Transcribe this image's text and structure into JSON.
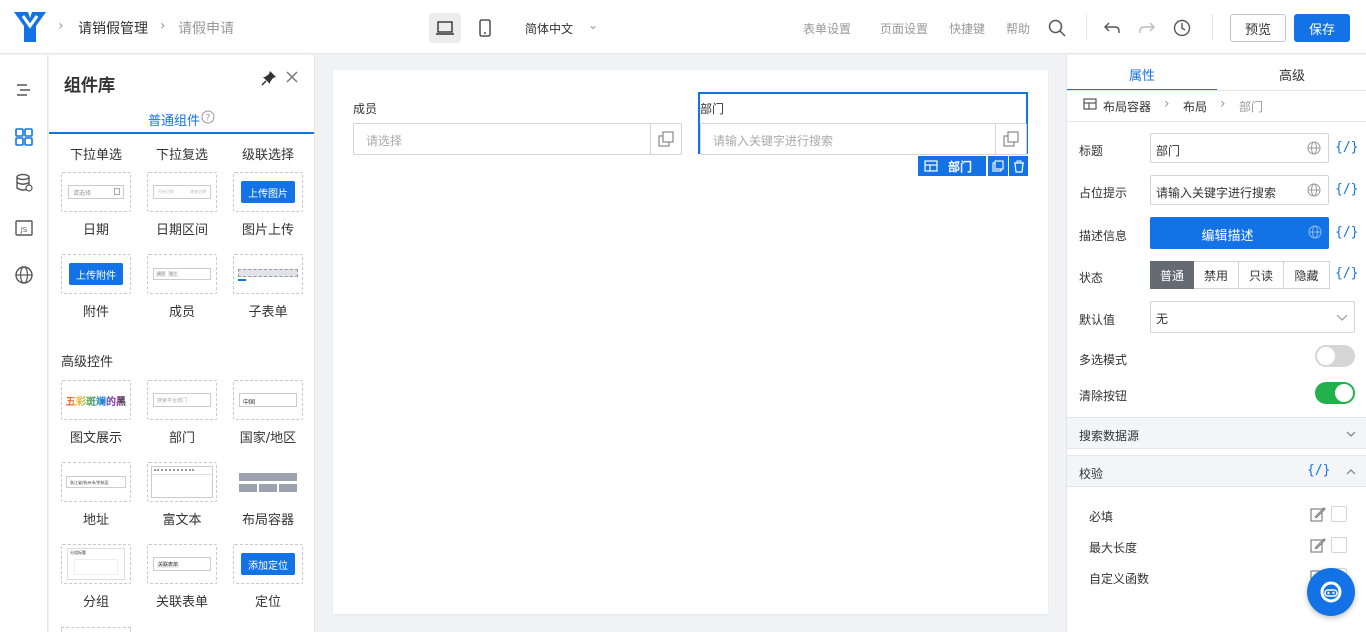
{
  "header": {
    "app_name": "请销假管理",
    "page_name": "请假申请",
    "language": "简体中文",
    "links": [
      "表单设置",
      "页面设置",
      "快捷键",
      "帮助"
    ],
    "preview_label": "预览",
    "save_label": "保存",
    "brand_color": "#1373e6"
  },
  "library": {
    "title": "组件库",
    "tab_label": "普通组件",
    "row0": [
      "下拉单选",
      "下拉复选",
      "级联选择"
    ],
    "row1": [
      "日期",
      "日期区间",
      "图片上传"
    ],
    "row2": [
      "附件",
      "成员",
      "子表单"
    ],
    "advanced_title": "高级控件",
    "row3": [
      "图文展示",
      "部门",
      "国家/地区"
    ],
    "row4": [
      "地址",
      "富文本",
      "布局容器"
    ],
    "row5": [
      "分组",
      "关联表单",
      "定位"
    ],
    "thumbs": {
      "date_ph": "请选择",
      "daterange_start": "开始日期",
      "daterange_end": "结束日期",
      "upload_image": "上传图片",
      "upload_file": "上传附件",
      "member_tag1": "成员",
      "member_tag2": "张三",
      "rich_text": "五彩斑斓的黑",
      "dept_ph": "搜索平台部门",
      "country": "中国",
      "address": "浙江省/杭州市/余杭区",
      "assoc_tag": "关联表单",
      "group_title": "分组标题",
      "locate": "添加定位"
    }
  },
  "canvas": {
    "field1_label": "成员",
    "field1_placeholder": "请选择",
    "field2_label": "部门",
    "field2_placeholder": "请输入关键字进行搜索",
    "selected_tag": "部门"
  },
  "props": {
    "tab_props": "属性",
    "tab_advanced": "高级",
    "breadcrumb": [
      "布局容器",
      "布局",
      "部门"
    ],
    "title_label": "标题",
    "title_value": "部门",
    "placeholder_label": "占位提示",
    "placeholder_value": "请输入关键字进行搜索",
    "desc_label": "描述信息",
    "desc_button": "编辑描述",
    "state_label": "状态",
    "states": [
      "普通",
      "禁用",
      "只读",
      "隐藏"
    ],
    "default_label": "默认值",
    "default_value": "无",
    "multi_label": "多选模式",
    "multi_on": false,
    "clear_label": "清除按钮",
    "clear_on": true,
    "datasource_label": "搜索数据源",
    "validate_label": "校验",
    "validations": [
      "必填",
      "最大长度",
      "自定义函数"
    ],
    "curly": "{/}"
  }
}
